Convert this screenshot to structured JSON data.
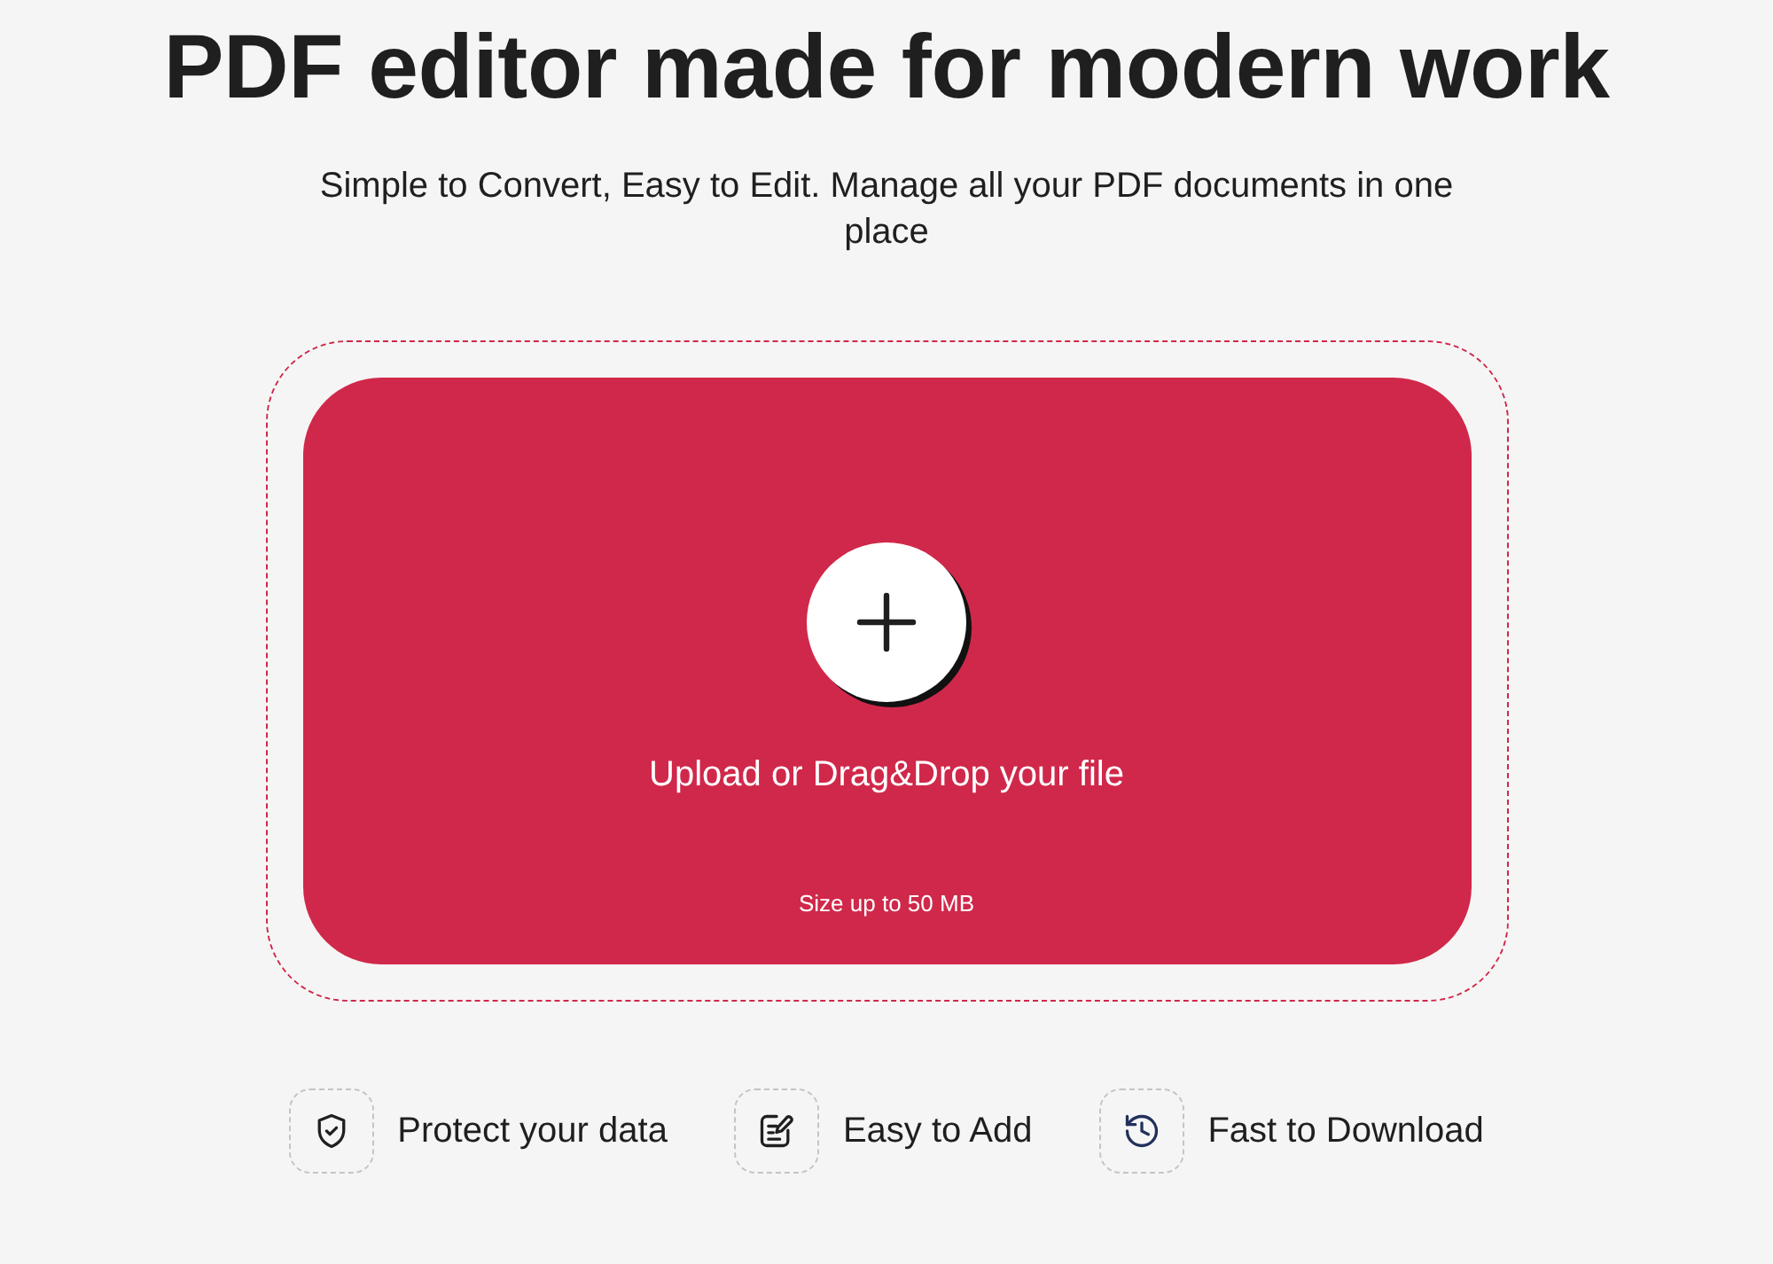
{
  "hero": {
    "title": "PDF editor made for modern work",
    "subtitle": "Simple to Convert, Easy to Edit. Manage all your PDF documents in one place"
  },
  "upload": {
    "label": "Upload or Drag&Drop your file",
    "size_note": "Size up to 50 MB"
  },
  "features": [
    {
      "kind": "shield",
      "label": "Protect your data"
    },
    {
      "kind": "edit",
      "label": "Easy to Add"
    },
    {
      "kind": "history",
      "label": "Fast to Download"
    }
  ]
}
